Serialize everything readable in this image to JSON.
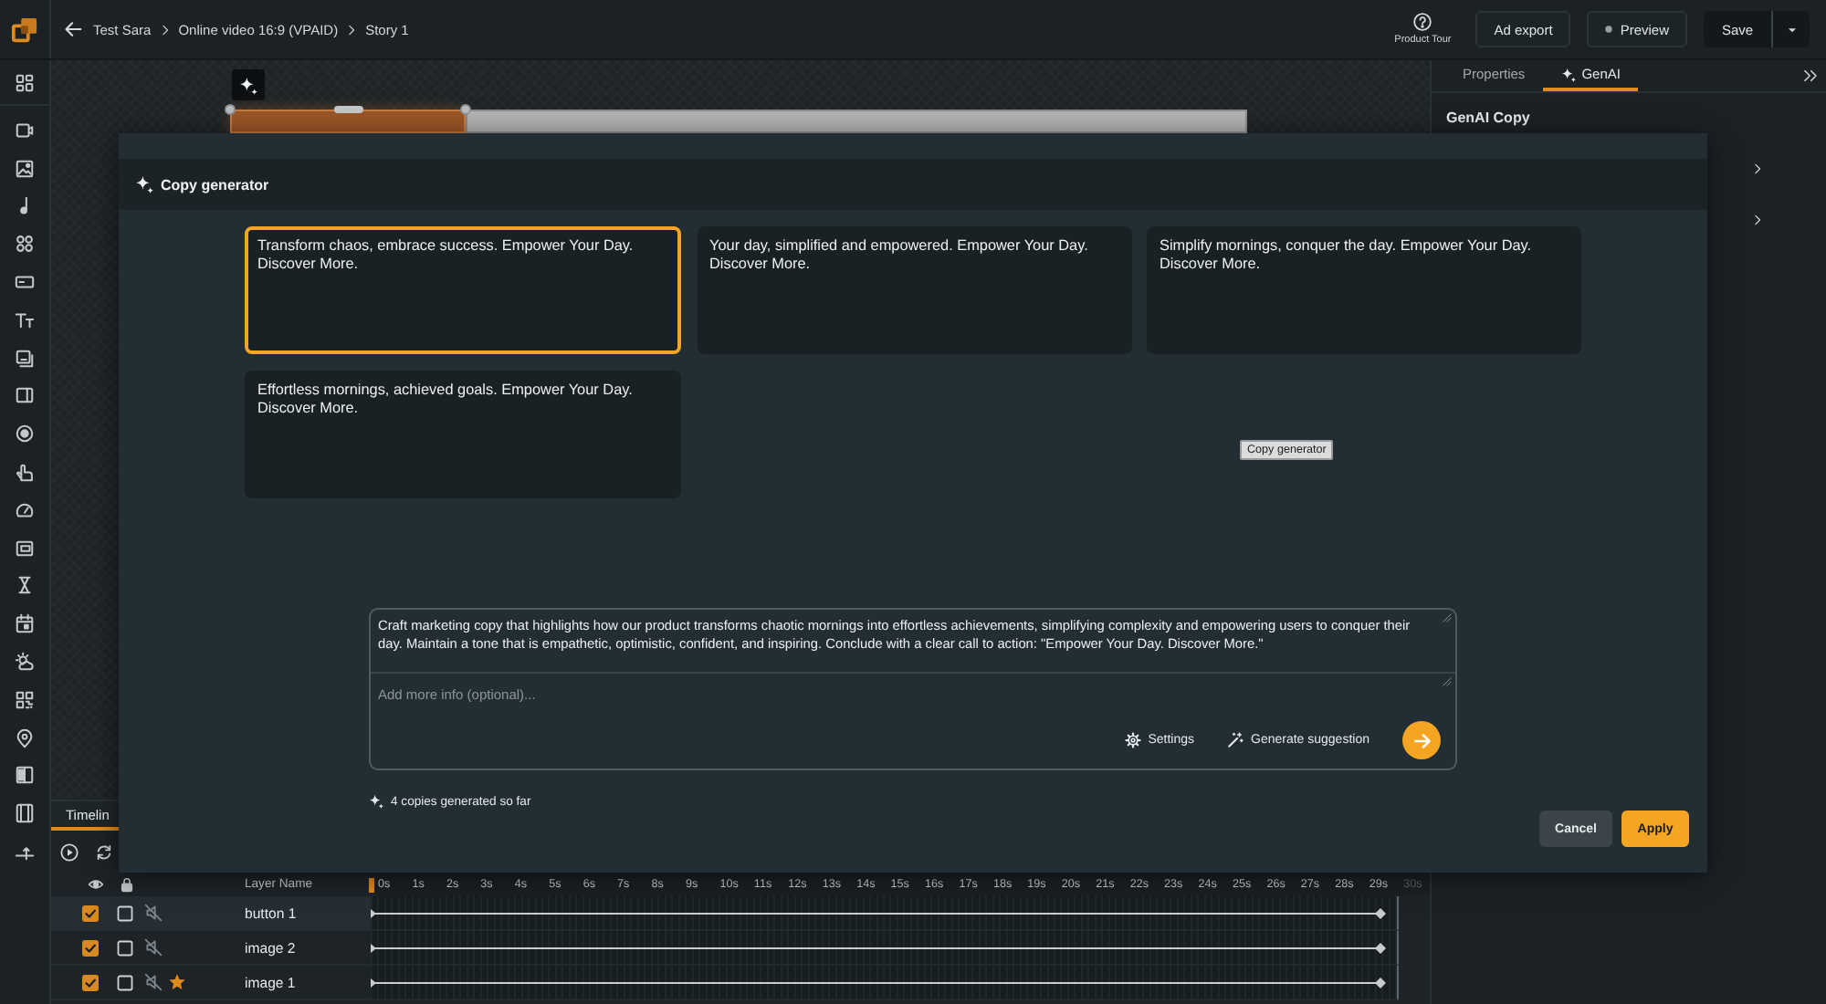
{
  "topbar": {
    "breadcrumb": [
      "Test Sara",
      "Online video 16:9 (VPAID)",
      "Story 1"
    ],
    "help": "Product Tour",
    "buttons": [
      {
        "label": "Ad export",
        "kind": "plain"
      },
      {
        "label": "Preview",
        "kind": "dot"
      },
      {
        "label": "Save",
        "kind": "split"
      }
    ]
  },
  "right_panel": {
    "tabs": [
      {
        "label": "Properties",
        "kind": "text",
        "selected": false
      },
      {
        "label": "GenAI",
        "kind": "sparkle",
        "selected": true
      }
    ],
    "section_title": "GenAI Copy"
  },
  "timeline": {
    "tabs": [
      {
        "label": "Timelin",
        "selected": true
      }
    ],
    "layer_column": "Layer Name",
    "ticks": [
      {
        "label": "0s",
        "disabled": false
      },
      {
        "label": "1s",
        "disabled": false
      },
      {
        "label": "2s",
        "disabled": false
      },
      {
        "label": "3s",
        "disabled": false
      },
      {
        "label": "4s",
        "disabled": false
      },
      {
        "label": "5s",
        "disabled": false
      },
      {
        "label": "6s",
        "disabled": false
      },
      {
        "label": "7s",
        "disabled": false
      },
      {
        "label": "8s",
        "disabled": false
      },
      {
        "label": "9s",
        "disabled": false
      },
      {
        "label": "10s",
        "disabled": false
      },
      {
        "label": "11s",
        "disabled": false
      },
      {
        "label": "12s",
        "disabled": false
      },
      {
        "label": "13s",
        "disabled": false
      },
      {
        "label": "14s",
        "disabled": false
      },
      {
        "label": "15s",
        "disabled": false
      },
      {
        "label": "16s",
        "disabled": false
      },
      {
        "label": "17s",
        "disabled": false
      },
      {
        "label": "18s",
        "disabled": false
      },
      {
        "label": "19s",
        "disabled": false
      },
      {
        "label": "20s",
        "disabled": false
      },
      {
        "label": "21s",
        "disabled": false
      },
      {
        "label": "22s",
        "disabled": false
      },
      {
        "label": "23s",
        "disabled": false
      },
      {
        "label": "24s",
        "disabled": false
      },
      {
        "label": "25s",
        "disabled": false
      },
      {
        "label": "26s",
        "disabled": false
      },
      {
        "label": "27s",
        "disabled": false
      },
      {
        "label": "28s",
        "disabled": false
      },
      {
        "label": "29s",
        "disabled": false
      },
      {
        "label": "30s",
        "disabled": true
      }
    ],
    "layers": [
      {
        "name": "button 1",
        "selected": true,
        "visible": true,
        "locked": false,
        "starred": false
      },
      {
        "name": "image 2",
        "selected": false,
        "visible": true,
        "locked": false,
        "starred": false
      },
      {
        "name": "image 1",
        "selected": false,
        "visible": true,
        "locked": false,
        "starred": true
      }
    ]
  },
  "modal": {
    "title": "Copy generator",
    "copies": [
      {
        "text": "Transform chaos, embrace success. Empower Your Day. Discover More.",
        "selected": true
      },
      {
        "text": "Your day, simplified and empowered. Empower Your Day. Discover More.",
        "selected": false
      },
      {
        "text": "Simplify mornings, conquer the day. Empower Your Day. Discover More.",
        "selected": false
      },
      {
        "text": "Effortless mornings, achieved goals. Empower Your Day. Discover More.",
        "selected": false
      }
    ],
    "tooltip": "Copy generator",
    "prompt": {
      "value": "Craft marketing copy that highlights how our product transforms chaotic mornings into effortless achievements, simplifying complexity and empowering users to conquer their day. Maintain a tone that is empathetic, optimistic, confident, and inspiring. Conclude with a clear call to action: \"Empower Your Day. Discover More.\"",
      "placeholder": "Add more info (optional)..."
    },
    "actions": [
      {
        "label": "Settings",
        "kind": "settings"
      },
      {
        "label": "Generate suggestion",
        "kind": "suggest"
      }
    ],
    "counter": "4 copies generated so far",
    "buttons": [
      {
        "label": "Cancel",
        "kind": "secondary"
      },
      {
        "label": "Apply",
        "kind": "primary"
      }
    ]
  }
}
